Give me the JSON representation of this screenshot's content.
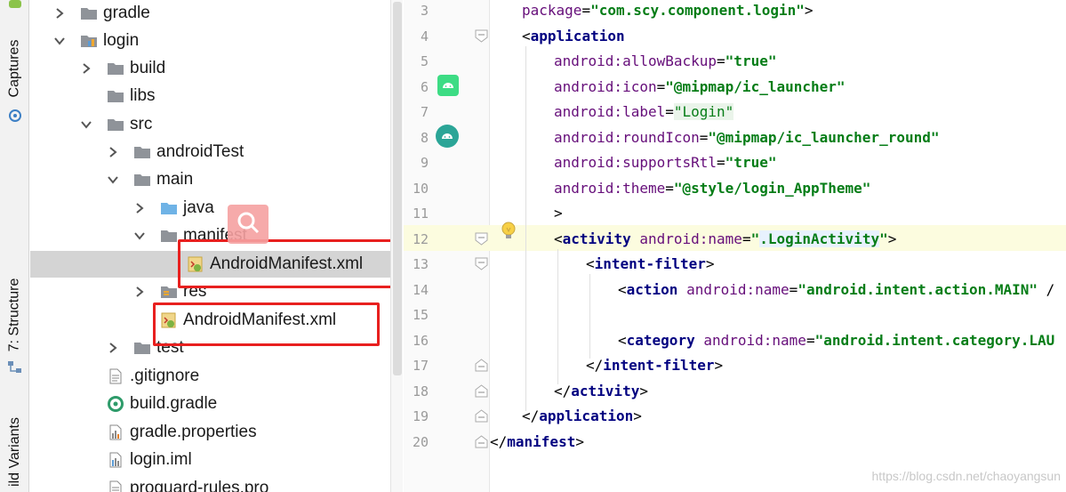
{
  "sidebar": {
    "tabs": [
      {
        "label": "Captures"
      },
      {
        "label": "7: Structure"
      },
      {
        "label": "ild Variants"
      }
    ]
  },
  "tree": {
    "items": [
      {
        "label": "gradle",
        "icon": "folder-icon",
        "expanded": false
      },
      {
        "label": "login",
        "icon": "module-folder-icon",
        "expanded": true
      },
      {
        "label": "build",
        "icon": "folder-icon",
        "expanded": false
      },
      {
        "label": "libs",
        "icon": "folder-icon"
      },
      {
        "label": "src",
        "icon": "folder-icon",
        "expanded": true
      },
      {
        "label": "androidTest",
        "icon": "folder-icon",
        "expanded": false
      },
      {
        "label": "main",
        "icon": "folder-icon",
        "expanded": true
      },
      {
        "label": "java",
        "icon": "source-folder-icon",
        "expanded": false
      },
      {
        "label": "manifest",
        "icon": "folder-icon",
        "expanded": true
      },
      {
        "label": "AndroidManifest.xml",
        "icon": "manifest-file-icon",
        "selected": true
      },
      {
        "label": "res",
        "icon": "resource-folder-icon",
        "expanded": false
      },
      {
        "label": "AndroidManifest.xml",
        "icon": "manifest-file-icon"
      },
      {
        "label": "test",
        "icon": "folder-icon",
        "expanded": false
      },
      {
        "label": ".gitignore",
        "icon": "text-file-icon"
      },
      {
        "label": "build.gradle",
        "icon": "gradle-file-icon"
      },
      {
        "label": "gradle.properties",
        "icon": "properties-file-icon"
      },
      {
        "label": "login.iml",
        "icon": "iml-file-icon"
      },
      {
        "label": "proguard-rules.pro",
        "icon": "text-file-icon"
      }
    ]
  },
  "editor": {
    "line_numbers": [
      "3",
      "4",
      "5",
      "6",
      "7",
      "8",
      "9",
      "10",
      "11",
      "12",
      "13",
      "14",
      "15",
      "16",
      "17",
      "18",
      "19",
      "20"
    ],
    "lines": {
      "l3": {
        "attr": "package",
        "eq": "=",
        "val": "\"com.scy.component.login\"",
        "end": ">"
      },
      "l4": {
        "open": "<",
        "tag": "application"
      },
      "l5": {
        "ns": "android:",
        "attr": "allowBackup",
        "eq": "=",
        "val": "\"true\""
      },
      "l6": {
        "ns": "android:",
        "attr": "icon",
        "eq": "=",
        "val": "\"@mipmap/ic_launcher\""
      },
      "l7": {
        "ns": "android:",
        "attr": "label",
        "eq": "=",
        "val": "\"Login\""
      },
      "l8": {
        "ns": "android:",
        "attr": "roundIcon",
        "eq": "=",
        "val": "\"@mipmap/ic_launcher_round\""
      },
      "l9": {
        "ns": "android:",
        "attr": "supportsRtl",
        "eq": "=",
        "val": "\"true\""
      },
      "l10": {
        "ns": "android:",
        "attr": "theme",
        "eq": "=",
        "val": "\"@style/login_AppTheme\""
      },
      "l11": {
        "end": ">"
      },
      "l12": {
        "open": "<",
        "tag": "activity",
        "ns": " android:",
        "attr": "name",
        "eq": "=",
        "q1": "\"",
        "valhl": ".LoginActivity",
        "q2": "\"",
        "end": ">"
      },
      "l13": {
        "open": "<",
        "tag": "intent-filter",
        "end": ">"
      },
      "l14": {
        "open": "<",
        "tag": "action",
        "ns": " android:",
        "attr": "name",
        "eq": "=",
        "val": "\"android.intent.action.MAIN\"",
        "end": " /"
      },
      "l16": {
        "open": "<",
        "tag": "category",
        "ns": " android:",
        "attr": "name",
        "eq": "=",
        "val": "\"android.intent.category.LAU"
      },
      "l17": {
        "open": "</",
        "tag": "intent-filter",
        "end": ">"
      },
      "l18": {
        "open": "</",
        "tag": "activity",
        "end": ">"
      },
      "l19": {
        "open": "</",
        "tag": "application",
        "end": ">"
      },
      "l20": {
        "open": "</",
        "tag": "manifest",
        "end": ">"
      }
    }
  },
  "watermark": "https://blog.csdn.net/chaoyangsun",
  "colors": {
    "tag": "#000080",
    "attribute": "#660e7a",
    "value": "#067d17",
    "selection_box": "#e8201f",
    "current_line": "#fcfcdf"
  }
}
